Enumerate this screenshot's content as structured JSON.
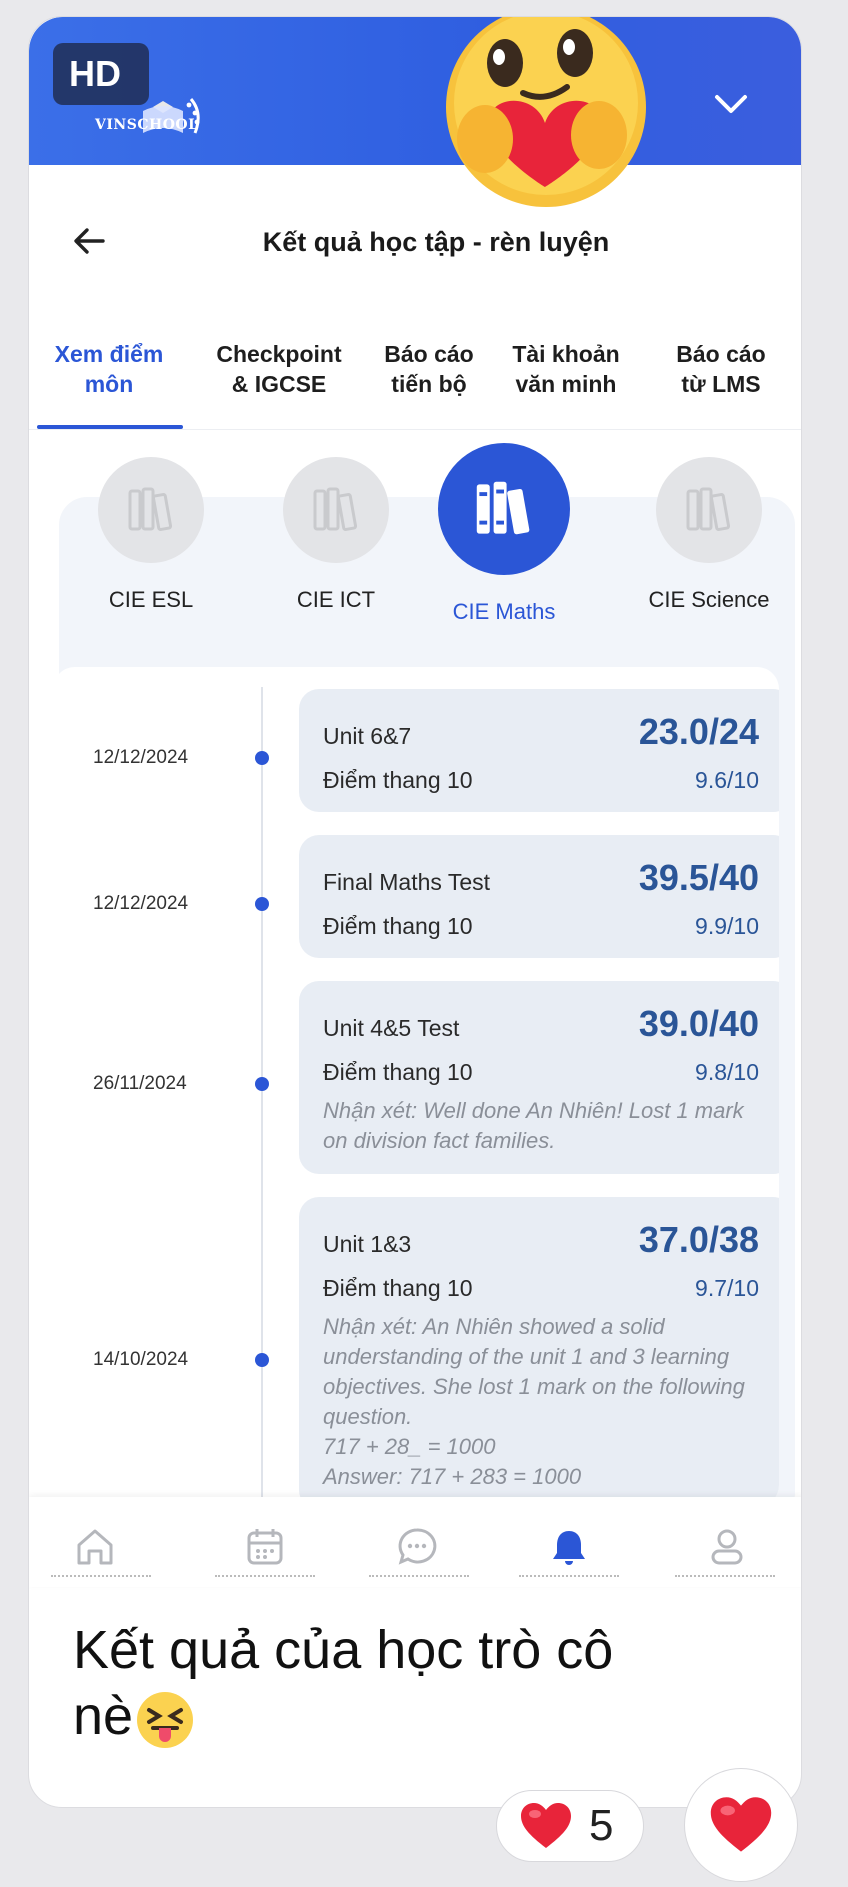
{
  "header": {
    "hd_badge": "HD",
    "school_name": "VINSCHOOL"
  },
  "page": {
    "title": "Kết quả học tập - rèn luyện"
  },
  "tabs": [
    {
      "line1": "Xem điểm",
      "line2": "môn",
      "active": true
    },
    {
      "line1": "Checkpoint",
      "line2": "& IGCSE",
      "active": false
    },
    {
      "line1": "Báo cáo",
      "line2": "tiến bộ",
      "active": false
    },
    {
      "line1": "Tài khoản",
      "line2": "văn minh",
      "active": false
    },
    {
      "line1": "Báo cáo",
      "line2": "từ LMS",
      "active": false
    }
  ],
  "subjects": [
    {
      "label": "CIE ESL",
      "active": false
    },
    {
      "label": "CIE ICT",
      "active": false
    },
    {
      "label": "CIE Maths",
      "active": true
    },
    {
      "label": "CIE Science",
      "active": false
    }
  ],
  "entries": [
    {
      "date": "12/12/2024",
      "name": "Unit 6&7",
      "score": "23.0/24",
      "scale_label": "Điểm thang 10",
      "scale_value": "9.6/10",
      "comment": ""
    },
    {
      "date": "12/12/2024",
      "name": "Final Maths Test",
      "score": "39.5/40",
      "scale_label": "Điểm thang 10",
      "scale_value": "9.9/10",
      "comment": ""
    },
    {
      "date": "26/11/2024",
      "name": "Unit 4&5 Test",
      "score": "39.0/40",
      "scale_label": "Điểm thang 10",
      "scale_value": "9.8/10",
      "comment": "Nhận xét: Well done An Nhiên! Lost 1 mark on division fact families."
    },
    {
      "date": "14/10/2024",
      "name": "Unit 1&3",
      "score": "37.0/38",
      "scale_label": "Điểm thang 10",
      "scale_value": "9.7/10",
      "comment": "Nhận xét: An Nhiên showed a solid understanding of the unit 1 and 3 learning objectives. She lost 1 mark on the following question.",
      "comment_line2": "717 + 28_ = 1000",
      "comment_line3": "Answer: 717 + 283 = 1000"
    }
  ],
  "bottom_nav": [
    {
      "icon": "home-icon"
    },
    {
      "icon": "calendar-icon"
    },
    {
      "icon": "chat-icon"
    },
    {
      "icon": "bell-icon",
      "active": true
    },
    {
      "icon": "account-icon"
    }
  ],
  "post": {
    "caption_line1": "Kết quả của học trò cô",
    "caption_line2": "nè",
    "reaction_count": "5"
  },
  "colors": {
    "accent": "#2b56d6",
    "score": "#2a5597",
    "header": "#3b6fe8"
  }
}
